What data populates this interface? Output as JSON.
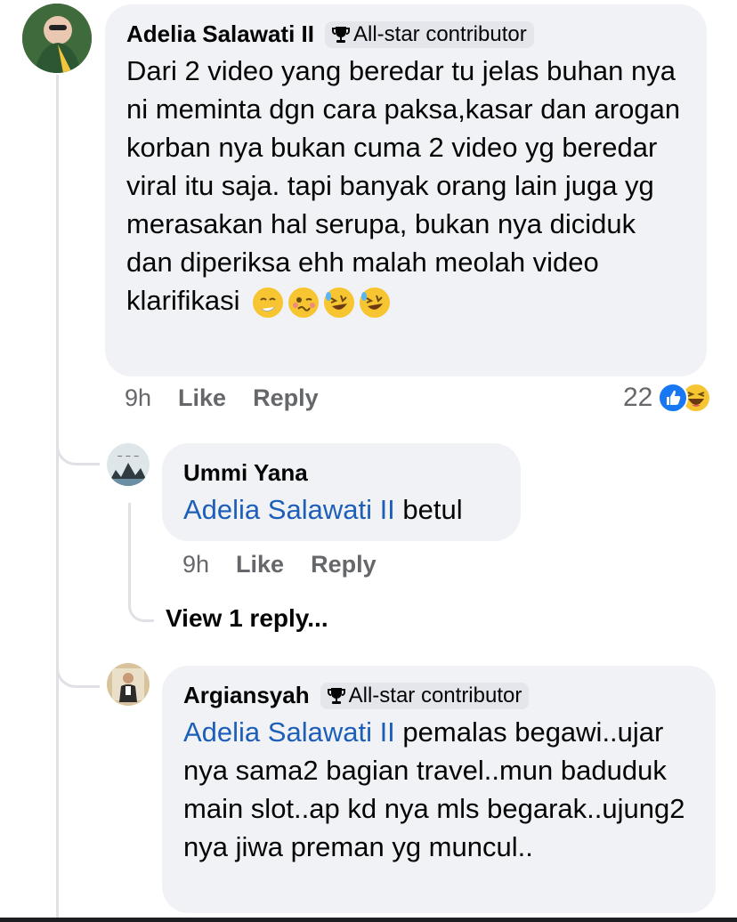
{
  "comments": [
    {
      "author": "Adelia Salawati II",
      "badge": "All-star contributor",
      "text": "Dari 2 video yang beredar tu jelas buhan nya ni meminta dgn cara paksa,kasar dan arogan korban nya bukan cuma 2 video yg beredar viral itu saja. tapi banyak orang lain juga yg merasakan hal serupa, bukan nya diciduk dan diperiksa ehh malah meolah video klarifikasi",
      "time": "9h",
      "like_label": "Like",
      "reply_label": "Reply",
      "reaction_count": "22",
      "emojis": [
        "sneezing-face",
        "woozy-face",
        "rolling-laughing-face",
        "rolling-laughing-face"
      ]
    }
  ],
  "replies": [
    {
      "author": "Ummi Yana",
      "mention": "Adelia Salawati II",
      "text": " betul",
      "time": "9h",
      "like_label": "Like",
      "reply_label": "Reply",
      "view_replies": "View 1 reply..."
    },
    {
      "author": "Argiansyah",
      "badge": "All-star contributor",
      "mention": "Adelia Salawati II",
      "text": " pemalas begawi..ujar nya sama2 bagian travel..mun baduduk main slot..ap kd nya mls begarak..ujung2 nya jiwa preman yg muncul.."
    }
  ],
  "colors": {
    "bubble": "#f0f2f5",
    "mention": "#1d5fb8",
    "meta": "#65676b",
    "like_blue": "#1877f2"
  }
}
